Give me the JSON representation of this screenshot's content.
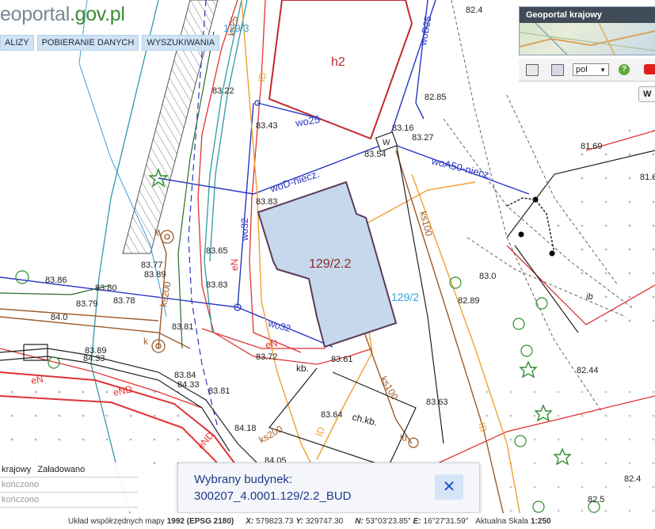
{
  "header": {
    "logo_main": "eoportal",
    "logo_domain": ".gov.pl",
    "menu": [
      {
        "label": "ALIZY"
      },
      {
        "label": "POBIERANIE DANYCH"
      },
      {
        "label": "WYSZUKIWANIA"
      }
    ]
  },
  "geoportal_panel": {
    "title": "Geoportal krajowy",
    "language": "pol",
    "help_label": "?",
    "side_button_label": "W"
  },
  "map": {
    "building_label": "129/2.2",
    "building_h2": "h2",
    "parcel_label_top": "129/3",
    "parcel_label_right": "129/2",
    "utility_labels": [
      "wo25",
      "woD-niecz.",
      "woA50-niecz.",
      "wo32",
      "wo32",
      "woD25",
      "eN",
      "eN",
      "eN",
      "eND",
      "eND",
      "ks200",
      "ks200",
      "ks100",
      "ks100",
      "ks25",
      "ID",
      "ID",
      "ID",
      "kl",
      "k",
      "k",
      "W",
      "ib"
    ],
    "elevations": [
      "82.4",
      "83.22",
      "83.43",
      "82.85",
      "83.16",
      "83.27",
      "83.54",
      "81.69",
      "81.6",
      "83.83",
      "83.65",
      "83.77",
      "83.89",
      "83.86",
      "83.80",
      "83.78",
      "83.79",
      "83.83",
      "84.0",
      "83.81",
      "83.89",
      "84.33",
      "83.72",
      "83.61",
      "83.0",
      "82.89",
      "82.44",
      "83.84",
      "84.33",
      "83.81",
      "83.64",
      "83.63",
      "84.18",
      "84.05",
      "82.4",
      "82.5"
    ],
    "annotations": [
      "kb.",
      "ch.kb."
    ]
  },
  "layers": {
    "rows": [
      {
        "name": "krajowy",
        "status": "Załadowano"
      },
      {
        "name": "",
        "status": "kończono"
      },
      {
        "name": "",
        "status": "kończono"
      }
    ]
  },
  "popup": {
    "title": "Wybrany budynek:",
    "building_id": "300207_4.0001.129/2.2_BUD",
    "close_label": "✕"
  },
  "statusbar": {
    "label": "Układ współrzędnych mapy",
    "crs": "1992 (EPSG 2180)",
    "x_label": "X:",
    "x_value": "579823.73",
    "y_label": "Y:",
    "y_value": "329747.30",
    "n_label": "N:",
    "n_value": "53°03'23.85\"",
    "e_label": "E:",
    "e_value": "16°27'31.59\"",
    "scale_label": "Aktualna Skala",
    "scale_value": "1:250"
  },
  "colors": {
    "building_fill": "#c6d9ec",
    "building_outline": "#5a3a55",
    "parcel_line": "#e03333",
    "water_line": "#2a37c4",
    "sewer_line": "#9c5a2a",
    "gas_line": "#f0a030",
    "popup_text": "#1f3a8a"
  }
}
